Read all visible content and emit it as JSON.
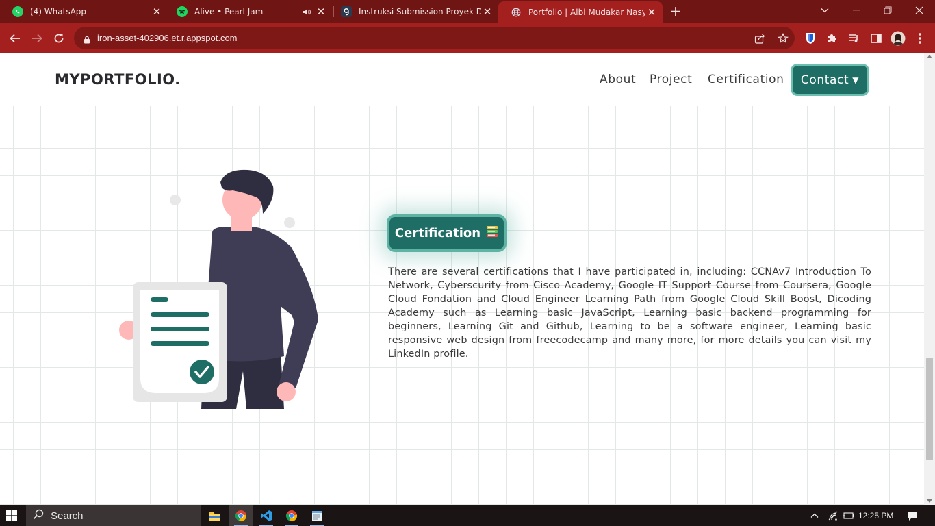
{
  "browser": {
    "tabs": [
      {
        "title": "(4) WhatsApp",
        "icon": "whatsapp-icon",
        "active": false
      },
      {
        "title": "Alive • Pearl Jam",
        "icon": "spotify-icon",
        "active": false,
        "audio": true
      },
      {
        "title": "Instruksi Submission Proyek Dep",
        "icon": "dicoding-icon",
        "active": false
      },
      {
        "title": "Portfolio | Albi Mudakar Nasyabi",
        "icon": "globe-icon",
        "active": true
      }
    ],
    "address": "iron-asset-402906.et.r.appspot.com",
    "accent_color": "#a3201f",
    "tabstrip_color": "#6f1514"
  },
  "site": {
    "logo": "MYPORTFOLIO.",
    "nav": {
      "about": "About",
      "project": "Project",
      "certification": "Certification",
      "contact": "Contact"
    },
    "section": {
      "badge": "Certification",
      "badge_emoji": "books-icon",
      "description": "There are several certifications that I have participated in, including: CCNAv7 Introduction To Network, Cyberscurity from Cisco Academy, Google IT Support Course from Coursera, Google Cloud Fondation and Cloud Engineer Learning Path from Google Cloud Skill Boost, Dicoding Academy such as Learning basic JavaScript, Learning basic backend programming for beginners, Learning Git and Github, Learning to be a software engineer, Learning basic responsive web design from freecodecamp and many more, for more details you can visit my LinkedIn profile."
    },
    "accent_color": "#1f6e65"
  },
  "taskbar": {
    "search_placeholder": "Search",
    "time": "12:25 PM",
    "apps": [
      "file-explorer-icon",
      "chrome-icon",
      "vscode-icon",
      "chrome-icon",
      "notepad-icon"
    ]
  }
}
